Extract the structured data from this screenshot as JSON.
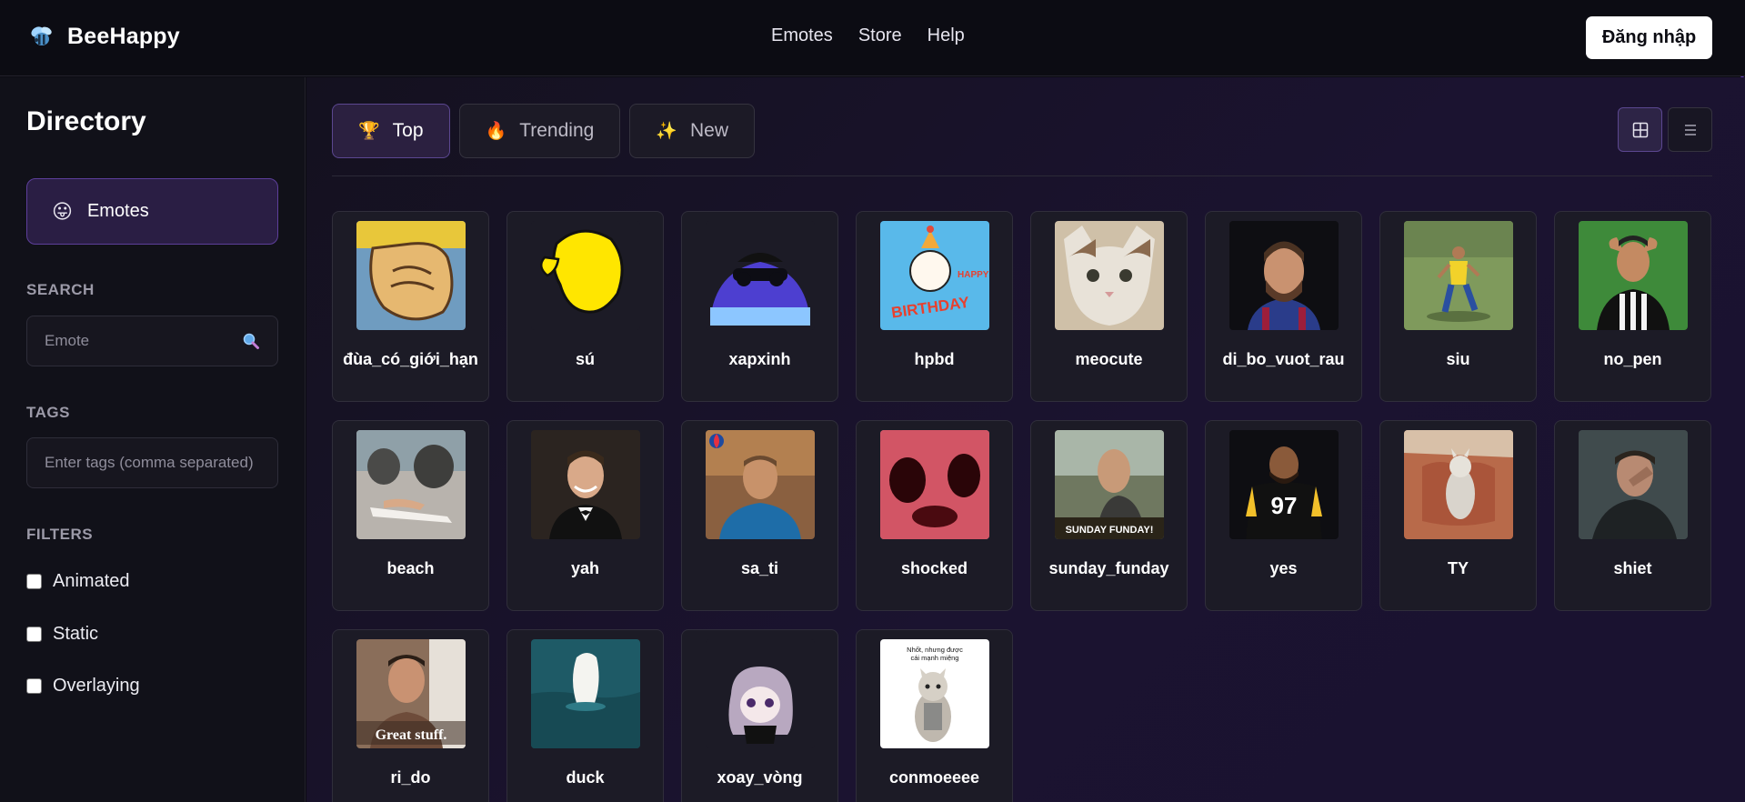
{
  "app": {
    "name": "BeeHappy",
    "logo_icon": "bee-logo-icon"
  },
  "nav": {
    "items": [
      {
        "label": "Emotes"
      },
      {
        "label": "Store"
      },
      {
        "label": "Help"
      }
    ],
    "login_label": "Đăng nhập"
  },
  "sidebar": {
    "title": "Directory",
    "emotes_button": {
      "emoji": "😛",
      "label": "Emotes"
    },
    "search": {
      "label": "SEARCH",
      "placeholder": "Emote",
      "value": ""
    },
    "tags": {
      "label": "TAGS",
      "placeholder": "Enter tags (comma separated)",
      "value": ""
    },
    "filters": {
      "label": "FILTERS",
      "options": [
        {
          "label": "Animated",
          "checked": false
        },
        {
          "label": "Static",
          "checked": false
        },
        {
          "label": "Overlaying",
          "checked": false
        }
      ]
    }
  },
  "tabs": [
    {
      "icon": "🏆",
      "label": "Top",
      "active": true
    },
    {
      "icon": "🔥",
      "label": "Trending",
      "active": false
    },
    {
      "icon": "✨",
      "label": "New",
      "active": false
    }
  ],
  "view_modes": [
    {
      "icon": "grid-icon",
      "active": true
    },
    {
      "icon": "list-icon",
      "active": false
    }
  ],
  "emotes": [
    {
      "name": "đùa_có_giới_hạn"
    },
    {
      "name": "sú"
    },
    {
      "name": "xapxinh"
    },
    {
      "name": "hpbd"
    },
    {
      "name": "meocute"
    },
    {
      "name": "di_bo_vuot_rau"
    },
    {
      "name": "siu"
    },
    {
      "name": "no_pen"
    },
    {
      "name": "beach"
    },
    {
      "name": "yah"
    },
    {
      "name": "sa_ti"
    },
    {
      "name": "shocked"
    },
    {
      "name": "sunday_funday"
    },
    {
      "name": "yes"
    },
    {
      "name": "TY"
    },
    {
      "name": "shiet"
    },
    {
      "name": "ri_do"
    },
    {
      "name": "duck"
    },
    {
      "name": "xoay_vòng"
    },
    {
      "name": "conmoeeee"
    }
  ],
  "thumb_text": {
    "hpbd_1": "HAPPY",
    "hpbd_2": "BIRTHDAY",
    "sunday": "SUNDAY FUNDAY!",
    "yes": "97",
    "rido": "Great stuff.",
    "conmoe": "Nhốt, nhưng được cái mạnh miệng"
  }
}
